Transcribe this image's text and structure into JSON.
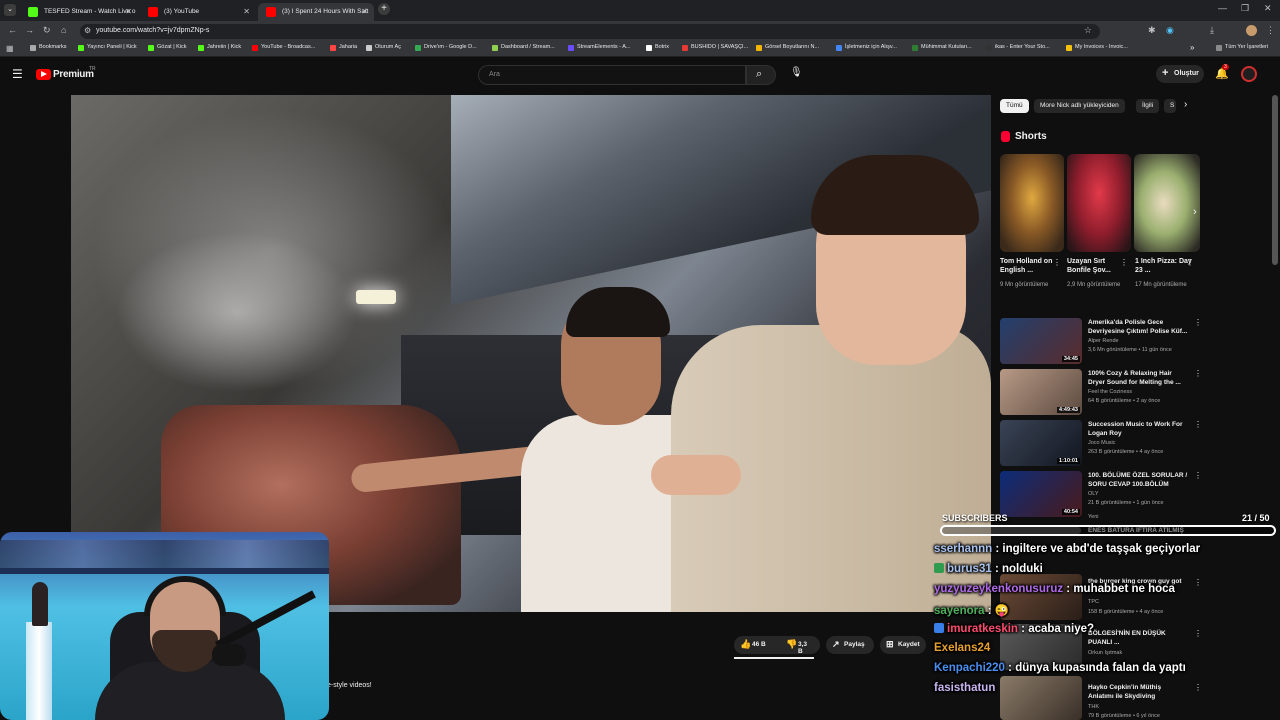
{
  "browser": {
    "tabs": [
      {
        "title": "TESFED Stream - Watch Live o",
        "favicon_color": "#53fc18",
        "active": false
      },
      {
        "title": "(3) YouTube",
        "favicon_color": "#ff0000",
        "active": false
      },
      {
        "title": "(3) I Spent 24 Hours With Salt",
        "favicon_color": "#ff0000",
        "active": true
      }
    ],
    "new_tab": "+",
    "url": "youtube.com/watch?v=jv7dpmZNp-s",
    "bookmarks": [
      {
        "label": "Bookmarks",
        "color": "#aaaaaa"
      },
      {
        "label": "Yayıncı Paneli | Kick",
        "color": "#53fc18"
      },
      {
        "label": "Gözat | Kick",
        "color": "#53fc18"
      },
      {
        "label": "Jahreiin | Kick",
        "color": "#53fc18"
      },
      {
        "label": "YouTube - Broadcas...",
        "color": "#ff0000"
      },
      {
        "label": "Jaharia",
        "color": "#ff4444"
      },
      {
        "label": "Oturum Aç",
        "color": "#cccccc"
      },
      {
        "label": "Drive'ım - Google D...",
        "color": "#34a853"
      },
      {
        "label": "Dashboard / Stream...",
        "color": "#8fd14f"
      },
      {
        "label": "StreamElements - A...",
        "color": "#6b4cff"
      },
      {
        "label": "Botrix",
        "color": "#ffffff"
      },
      {
        "label": "BUSHIDO | SAVAŞÇI...",
        "color": "#e53935"
      },
      {
        "label": "Görsel Boyutlarını N...",
        "color": "#f4b400"
      },
      {
        "label": "İşletmeniz için Alışv...",
        "color": "#4285f4"
      },
      {
        "label": "Mühimmat Kutuları...",
        "color": "#2e7d32"
      },
      {
        "label": "ikas - Enter Your Sto...",
        "color": "#333333"
      },
      {
        "label": "My Invoices - Invoic...",
        "color": "#f4c20d"
      }
    ],
    "bookmarks_more": "»",
    "all_bookmarks": "Tüm Yer İşaretleri"
  },
  "youtube": {
    "logo": "Premium",
    "logo_sup": "TR",
    "search_placeholder": "Ara",
    "create_label": "Oluştur",
    "notif_count": "3",
    "chips": [
      "Tümü",
      "More Nick adlı yükleyiciden",
      "İlgili",
      "S"
    ],
    "shorts_heading": "Shorts",
    "shorts": [
      {
        "title": "Tom Holland on English ...",
        "views": "9 Mn görüntüleme"
      },
      {
        "title": "Uzayan Sırt Bonfile Şov...",
        "views": "2,9 Mn görüntüleme"
      },
      {
        "title": "1 Inch Pizza: Day 23 ...",
        "views": "17 Mn görüntüleme"
      }
    ],
    "recommendations": [
      {
        "title": "Amerika'da Polisle Gece Devriyesine Çıktım! Polise Küf...",
        "channel": "Alper Rende",
        "meta": "3,6 Mn görüntüleme • 11 gün önce",
        "duration": "34:45",
        "thumb": "#2b4a7a"
      },
      {
        "title": "100% Cozy & Relaxing Hair Dryer Sound for Melting the ...",
        "channel": "Feel the Coziness",
        "meta": "64 B görüntüleme • 2 ay önce",
        "duration": "4:49:43",
        "thumb": "#6a5a4e"
      },
      {
        "title": "Succession Music to Work For Logan Roy",
        "channel": "Joco Music",
        "meta": "263 B görüntüleme • 4 ay önce",
        "duration": "1:10:01",
        "thumb": "#1f2838"
      },
      {
        "title": "100. BÖLÜME ÖZEL SORULAR / SORU CEVAP 100.BÖLÜM",
        "channel": "OLY",
        "meta": "21 B görüntüleme • 1 gün önce",
        "duration": "40:54",
        "thumb": "#0e2a6a"
      }
    ],
    "badge_new": "Yeni",
    "partial_items": [
      "ENES BATURA İFTİRA ATILMIŞ",
      "the burger king crown guy got",
      "TPC",
      "158 B görüntüleme • 4 ay önce",
      "BÖLGESİ'NİN EN DÜŞÜK PUANLI ...",
      "Orkun Işıtmak",
      "Hayko Cepkin'in Müthiş Anlatımı ile Skydiving",
      "THK",
      "79 B görüntüleme • 6 yıl önce"
    ],
    "actions": {
      "like": "46 B",
      "dislike": "3,3 B",
      "share": "Paylaş",
      "save": "Kaydet"
    },
    "desc_fragment": "e-style videos!"
  },
  "chat": {
    "header": "SUBSCRIBERS",
    "progress_text": "21 / 50",
    "progress_fraction": 0.42,
    "messages": [
      {
        "user": "sserhannn",
        "text": "ingiltere ve abd'de taşşak geçiyorlar",
        "color": "#a9c3f0",
        "badge": ""
      },
      {
        "user": "burus31",
        "text": "nolduki",
        "color": "#a9c3f0",
        "badge": "#2e9b4f"
      },
      {
        "user": "yuzyuzeykenkonusuruz",
        "text": "muhabbet ne hoca",
        "color": "#b16be8",
        "badge": ""
      },
      {
        "user": "sayenora",
        "text": "😜",
        "color": "#4fae5e",
        "badge": ""
      },
      {
        "user": "imuratkeskin",
        "text": "acaba niye?",
        "color": "#ff4b6e",
        "badge": "#3a7ee8"
      },
      {
        "user": "Exelans24",
        "text": "",
        "color": "#e8a12e",
        "badge": ""
      },
      {
        "user": "Kenpachi220",
        "text": "dünya kupasında falan da yaptı",
        "color": "#4a8ff0",
        "badge": ""
      },
      {
        "user": "fasisthatun",
        "text": "",
        "color": "#c8b4f0",
        "badge": ""
      }
    ]
  }
}
